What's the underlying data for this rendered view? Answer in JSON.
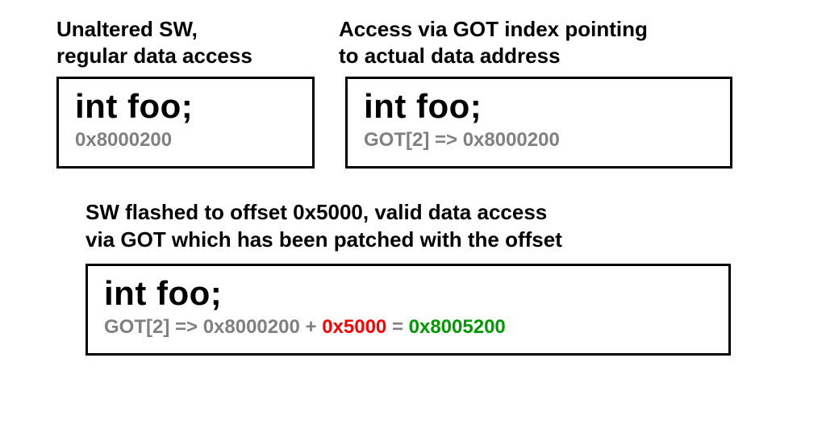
{
  "top_left": {
    "heading_line1": "Unaltered SW,",
    "heading_line2": "regular data access",
    "code": "int foo;",
    "sub": "0x8000200"
  },
  "top_right": {
    "heading_line1": "Access via GOT index pointing",
    "heading_line2": "to actual data address",
    "code": "int foo;",
    "sub": "GOT[2] => 0x8000200"
  },
  "bottom": {
    "heading_line1": "SW flashed to offset 0x5000, valid data access",
    "heading_line2": "via GOT which has been patched with the offset",
    "code": "int foo;",
    "expr": {
      "prefix": "GOT[2] => 0x8000200 + ",
      "offset": "0x5000",
      "equals": " = ",
      "result": "0x8005200"
    }
  }
}
